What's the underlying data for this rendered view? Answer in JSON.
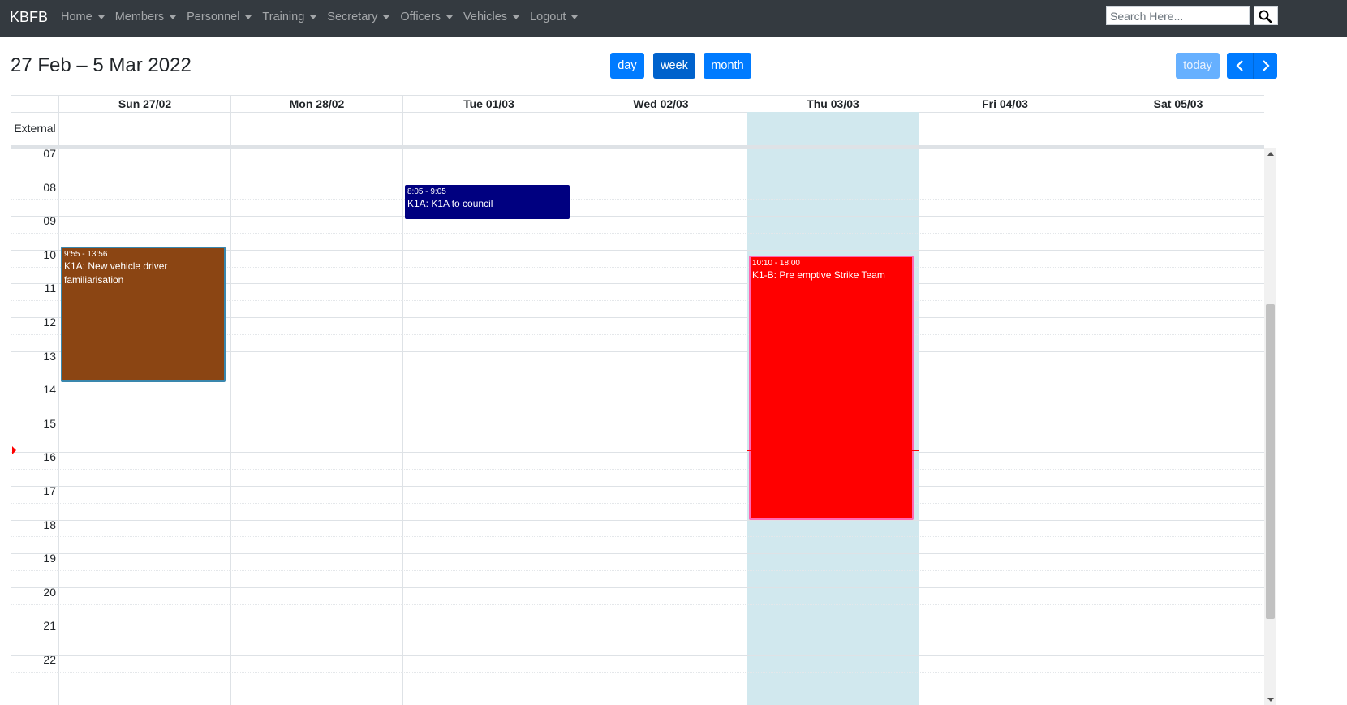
{
  "navbar": {
    "brand": "KBFB",
    "items": [
      {
        "label": "Home"
      },
      {
        "label": "Members"
      },
      {
        "label": "Personnel"
      },
      {
        "label": "Training"
      },
      {
        "label": "Secretary"
      },
      {
        "label": "Officers"
      },
      {
        "label": "Vehicles"
      },
      {
        "label": "Logout"
      }
    ],
    "search_placeholder": "Search Here..."
  },
  "toolbar": {
    "title": "27 Feb – 5 Mar 2022",
    "views": [
      {
        "label": "day",
        "active": false
      },
      {
        "label": "week",
        "active": true
      },
      {
        "label": "month",
        "active": false
      }
    ],
    "today_label": "today",
    "prev_icon": "chevron-left-icon",
    "next_icon": "chevron-right-icon"
  },
  "calendar": {
    "allday_label": "External",
    "days": [
      {
        "label": "Sun 27/02",
        "today": false
      },
      {
        "label": "Mon 28/02",
        "today": false
      },
      {
        "label": "Tue 01/03",
        "today": false
      },
      {
        "label": "Wed 02/03",
        "today": false
      },
      {
        "label": "Thu 03/03",
        "today": true
      },
      {
        "label": "Fri 04/03",
        "today": false
      },
      {
        "label": "Sat 05/03",
        "today": false
      }
    ],
    "hours": [
      "07",
      "08",
      "09",
      "10",
      "11",
      "12",
      "13",
      "14",
      "15",
      "16",
      "17",
      "18",
      "19",
      "20",
      "21",
      "22"
    ],
    "first_hour": 7,
    "now": 15.95,
    "events": [
      {
        "day": 2,
        "start": 8.0833,
        "end": 9.0833,
        "time": "8:05 - 9:05",
        "title": "K1A: K1A to council",
        "color": "#000080",
        "border": "#000080"
      },
      {
        "day": 0,
        "start": 9.9167,
        "end": 13.9333,
        "time": "9:55 - 13:56",
        "title": "K1A: New vehicle driver familiarisation",
        "color": "#8b4513",
        "border": "#3a87ad"
      },
      {
        "day": 4,
        "start": 10.1667,
        "end": 18.0,
        "time": "10:10 - 18:00",
        "title": "K1-B: Pre emptive Strike Team",
        "color": "#ff0000",
        "border": "#ff69b4"
      }
    ]
  },
  "colors": {
    "navbar_bg": "#343a40",
    "primary": "#007bff",
    "today_bg": "#d1e8ee",
    "now_indicator": "#ff0000"
  }
}
